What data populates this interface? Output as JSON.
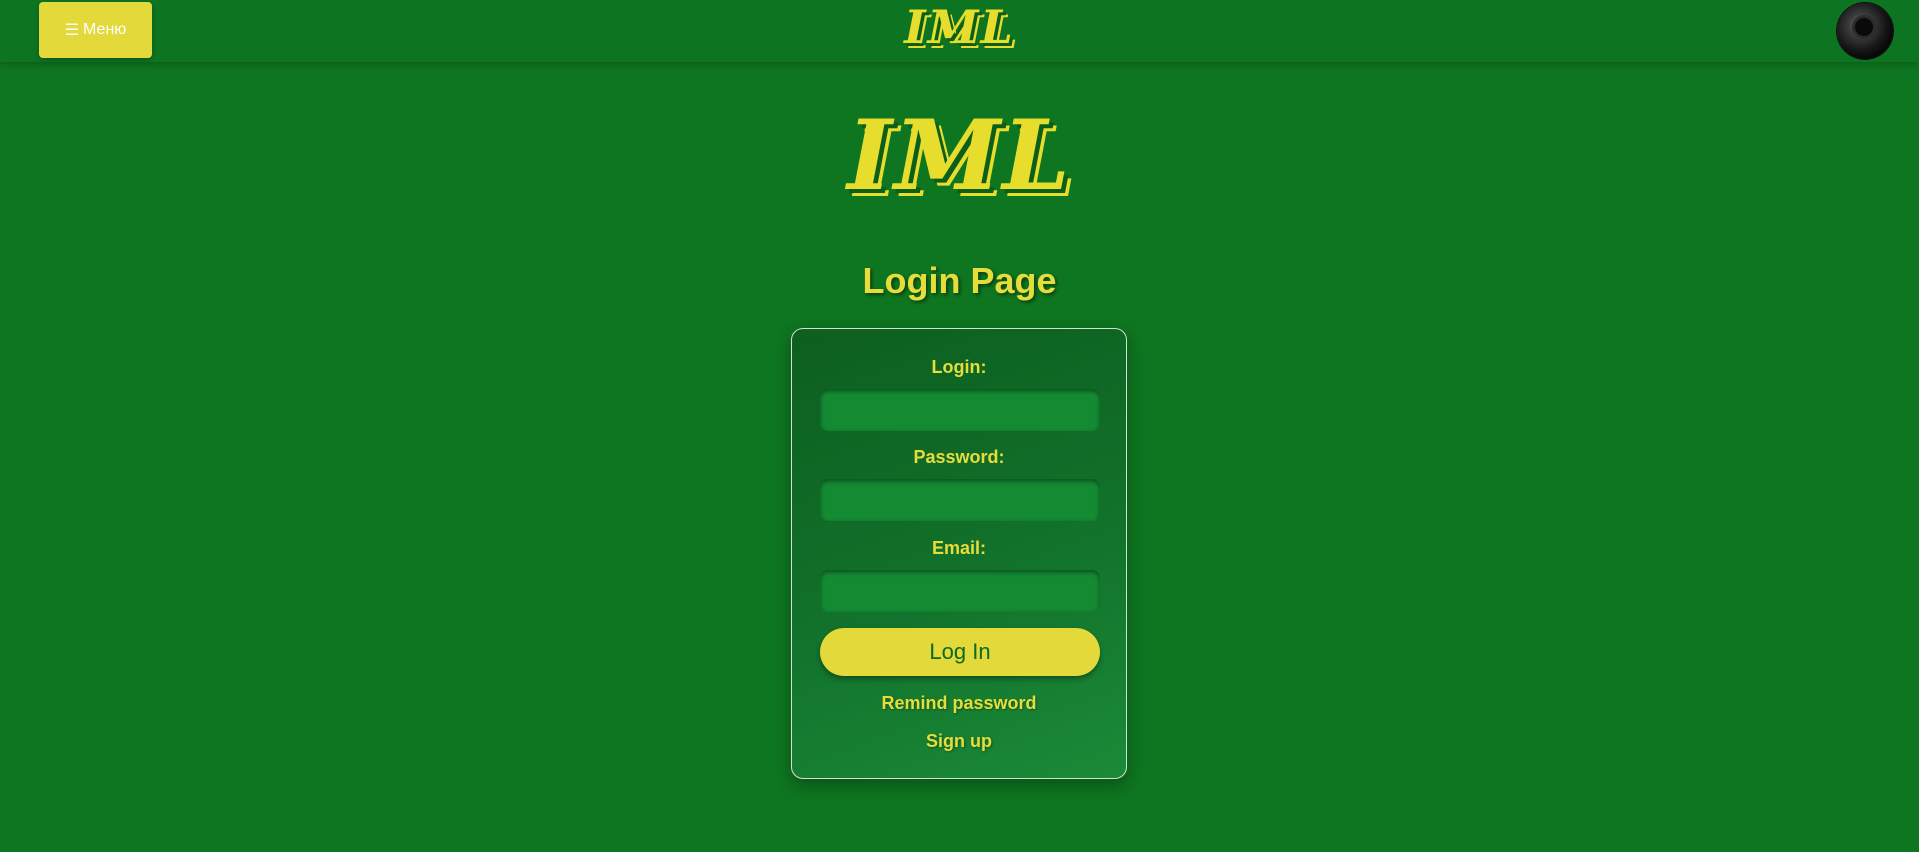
{
  "header": {
    "menu_icon": "☰",
    "menu_label": "Меню",
    "logo": "IML",
    "avatar_icon": "avatar-eye-icon"
  },
  "hero": {
    "logo": "IML"
  },
  "page_title": "Login Page",
  "form": {
    "login_label": "Login:",
    "login_value": "",
    "password_label": "Password:",
    "password_value": "",
    "email_label": "Email:",
    "email_value": "",
    "submit_label": "Log In",
    "remind_link": "Remind password",
    "signup_link": "Sign up"
  },
  "colors": {
    "background": "#0e7520",
    "accent": "#e3d93a",
    "text_accent": "#e6dd3a"
  }
}
